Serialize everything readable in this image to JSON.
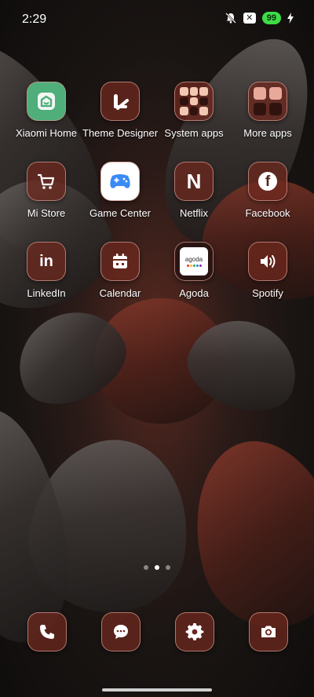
{
  "status_bar": {
    "time": "2:29",
    "battery_level": "99",
    "battery_color": "#3ddc45"
  },
  "apps": [
    {
      "label": "Xiaomi Home",
      "icon": "xiaomi-home-icon"
    },
    {
      "label": "Theme Designer",
      "icon": "theme-designer-icon"
    },
    {
      "label": "System apps",
      "icon": "system-apps-folder-icon"
    },
    {
      "label": "More apps",
      "icon": "more-apps-folder-icon"
    },
    {
      "label": "Mi Store",
      "icon": "cart-icon"
    },
    {
      "label": "Game Center",
      "icon": "gamepad-icon"
    },
    {
      "label": "Netflix",
      "icon": "netflix-icon",
      "glyph": "N"
    },
    {
      "label": "Facebook",
      "icon": "facebook-icon",
      "glyph": "f"
    },
    {
      "label": "LinkedIn",
      "icon": "linkedin-icon",
      "glyph": "in"
    },
    {
      "label": "Calendar",
      "icon": "calendar-icon"
    },
    {
      "label": "Agoda",
      "icon": "agoda-icon",
      "glyph": "agoda"
    },
    {
      "label": "Spotify",
      "icon": "spotify-icon"
    }
  ],
  "dock": [
    {
      "icon": "phone-icon"
    },
    {
      "icon": "messages-icon"
    },
    {
      "icon": "settings-icon"
    },
    {
      "icon": "camera-icon"
    }
  ],
  "page_indicator": {
    "pages": 3,
    "active": 2
  },
  "colors": {
    "icon_background": "#6e281e",
    "icon_border": "#d2968c"
  }
}
